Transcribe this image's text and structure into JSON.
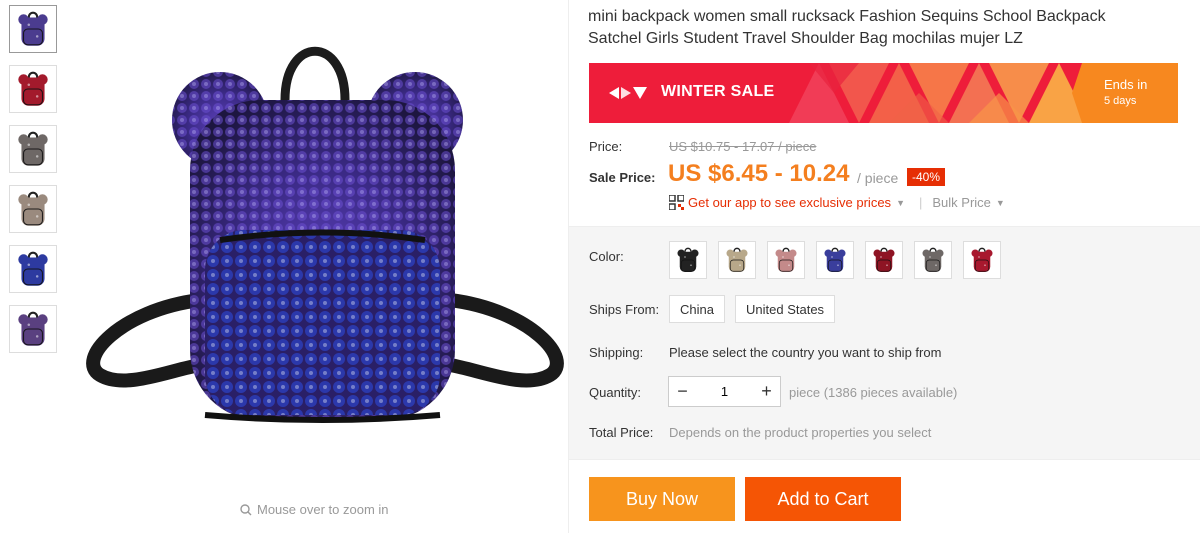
{
  "product": {
    "title": "mini backpack women small rucksack Fashion Sequins School Backpack Satchel Girls Student Travel Shoulder Bag mochilas mujer LZ"
  },
  "gallery": {
    "thumbnails": [
      {
        "name": "thumb-purple",
        "color": "#4b3c8f"
      },
      {
        "name": "thumb-red",
        "color": "#a31a2c"
      },
      {
        "name": "thumb-gray",
        "color": "#6e6866"
      },
      {
        "name": "thumb-lifestyle",
        "color": "#9a8a7e"
      },
      {
        "name": "thumb-detail-blue",
        "color": "#2d3aa0"
      },
      {
        "name": "thumb-inside",
        "color": "#5a4080"
      }
    ],
    "zoom_hint": "Mouse over to zoom in"
  },
  "banner": {
    "label": "WINTER SALE",
    "ends_line1": "Ends in",
    "ends_line2": "5 days",
    "color": "#ee1d3a",
    "ends_color": "#f7881f"
  },
  "pricing": {
    "price_label": "Price:",
    "original_price": "US $10.75 - 17.07 / piece",
    "sale_label": "Sale Price:",
    "sale_price": "US $6.45 - 10.24",
    "per_piece": "/ piece",
    "discount": "-40%",
    "app_link": "Get our app to see exclusive prices",
    "bulk_price": "Bulk Price",
    "accent": "#f47f1f"
  },
  "sku": {
    "color_label": "Color:",
    "colors": [
      {
        "name": "black",
        "hex": "#222222"
      },
      {
        "name": "gold",
        "hex": "#b8a88a"
      },
      {
        "name": "pink",
        "hex": "#c48a8a"
      },
      {
        "name": "blue",
        "hex": "#3a3e9c"
      },
      {
        "name": "red",
        "hex": "#8e1424"
      },
      {
        "name": "gray",
        "hex": "#6e6866"
      },
      {
        "name": "rose",
        "hex": "#a8182e"
      }
    ],
    "ships_from_label": "Ships From:",
    "ships_from_options": [
      "China",
      "United States"
    ],
    "shipping_label": "Shipping:",
    "shipping_text": "Please select the country you want to ship from",
    "quantity_label": "Quantity:",
    "quantity_value": "1",
    "quantity_minus": "−",
    "quantity_plus": "+",
    "quantity_available": "piece (1386 pieces available)",
    "total_label": "Total Price:",
    "total_text": "Depends on the product properties you select"
  },
  "actions": {
    "buy_now": "Buy Now",
    "add_to_cart": "Add to Cart"
  }
}
